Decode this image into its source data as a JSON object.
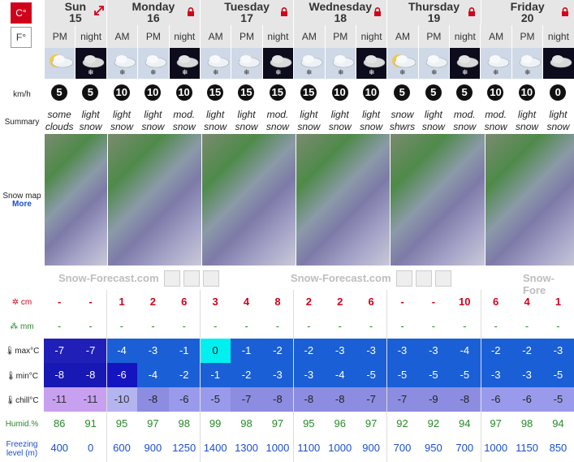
{
  "units": {
    "celsius": "C°",
    "fahrenheit": "F°"
  },
  "row_labels": {
    "wind": "km/h",
    "summary": "Summary",
    "snow_map": "Snow map",
    "more": "More",
    "snow": "cm",
    "rain": "mm",
    "max": "max°C",
    "min": "min°C",
    "chill": "chill°C",
    "humid": "Humid.%",
    "freezing_1": "Freezing",
    "freezing_2": "level (m)"
  },
  "days": [
    {
      "name": "Sun",
      "date": "15",
      "cols": 2,
      "icon": "expand-arrow-icon"
    },
    {
      "name": "Monday",
      "date": "16",
      "cols": 3,
      "icon": "lock-icon"
    },
    {
      "name": "Tuesday",
      "date": "17",
      "cols": 3,
      "icon": "lock-icon"
    },
    {
      "name": "Wednesday",
      "date": "18",
      "cols": 3,
      "icon": "lock-icon"
    },
    {
      "name": "Thursday",
      "date": "19",
      "cols": 3,
      "icon": "lock-icon"
    },
    {
      "name": "Friday",
      "date": "20",
      "cols": 3,
      "icon": "lock-icon"
    }
  ],
  "periods": [
    "PM",
    "night",
    "AM",
    "PM",
    "night",
    "AM",
    "PM",
    "night",
    "AM",
    "PM",
    "night",
    "AM",
    "PM",
    "night",
    "AM",
    "PM",
    "night"
  ],
  "weather_icons": [
    "partly-cloudy-icon",
    "cloud-snow-night-icon",
    "cloud-snow-icon",
    "cloud-snow-icon",
    "cloud-snow-night-icon",
    "cloud-snow-icon",
    "cloud-snow-icon",
    "cloud-snow-night-icon",
    "cloud-snow-icon",
    "cloud-snow-icon",
    "cloud-snow-night-icon",
    "partly-cloudy-snow-icon",
    "cloud-snow-icon",
    "cloud-snow-night-icon",
    "cloud-snow-icon",
    "cloud-snow-icon",
    "cloud-night-icon"
  ],
  "wind_speed": [
    "5",
    "5",
    "10",
    "10",
    "10",
    "15",
    "15",
    "15",
    "15",
    "10",
    "10",
    "5",
    "5",
    "5",
    "10",
    "10",
    "0"
  ],
  "summary": [
    [
      "some",
      "clouds"
    ],
    [
      "light",
      "snow"
    ],
    [
      "light",
      "snow"
    ],
    [
      "light",
      "snow"
    ],
    [
      "mod.",
      "snow"
    ],
    [
      "light",
      "snow"
    ],
    [
      "light",
      "snow"
    ],
    [
      "mod.",
      "snow"
    ],
    [
      "light",
      "snow"
    ],
    [
      "light",
      "snow"
    ],
    [
      "light",
      "snow"
    ],
    [
      "snow",
      "shwrs"
    ],
    [
      "light",
      "snow"
    ],
    [
      "mod.",
      "snow"
    ],
    [
      "mod.",
      "snow"
    ],
    [
      "light",
      "snow"
    ],
    [
      "light",
      "snow"
    ]
  ],
  "watermarks": [
    "Snow-Forecast.com",
    "Snow-Forecast.com",
    "Snow-Fore"
  ],
  "snow_cm": [
    "-",
    "-",
    "1",
    "2",
    "6",
    "3",
    "4",
    "8",
    "2",
    "2",
    "6",
    "-",
    "-",
    "10",
    "6",
    "4",
    "1"
  ],
  "rain_mm": [
    "-",
    "-",
    "-",
    "-",
    "-",
    "-",
    "-",
    "-",
    "-",
    "-",
    "-",
    "-",
    "-",
    "-",
    "-",
    "-",
    "-"
  ],
  "max_c": [
    "-7",
    "-7",
    "-4",
    "-3",
    "-1",
    "0",
    "-1",
    "-2",
    "-2",
    "-3",
    "-3",
    "-3",
    "-3",
    "-4",
    "-2",
    "-2",
    "-3"
  ],
  "min_c": [
    "-8",
    "-8",
    "-6",
    "-4",
    "-2",
    "-1",
    "-2",
    "-3",
    "-3",
    "-4",
    "-5",
    "-5",
    "-5",
    "-5",
    "-3",
    "-3",
    "-5"
  ],
  "chill_c": [
    "-11",
    "-11",
    "-10",
    "-8",
    "-6",
    "-5",
    "-7",
    "-8",
    "-8",
    "-8",
    "-7",
    "-7",
    "-9",
    "-8",
    "-6",
    "-6",
    "-5"
  ],
  "humid": [
    "86",
    "91",
    "95",
    "97",
    "98",
    "99",
    "98",
    "97",
    "95",
    "96",
    "97",
    "92",
    "92",
    "94",
    "97",
    "98",
    "94"
  ],
  "freezing_m": [
    "400",
    "0",
    "600",
    "900",
    "1250",
    "1400",
    "1300",
    "1000",
    "1100",
    "1000",
    "900",
    "700",
    "950",
    "700",
    "1000",
    "1150",
    "850"
  ],
  "colors": {
    "red": "#d0021b",
    "green": "#2a8a2a",
    "blue": "#1a4fd1"
  }
}
